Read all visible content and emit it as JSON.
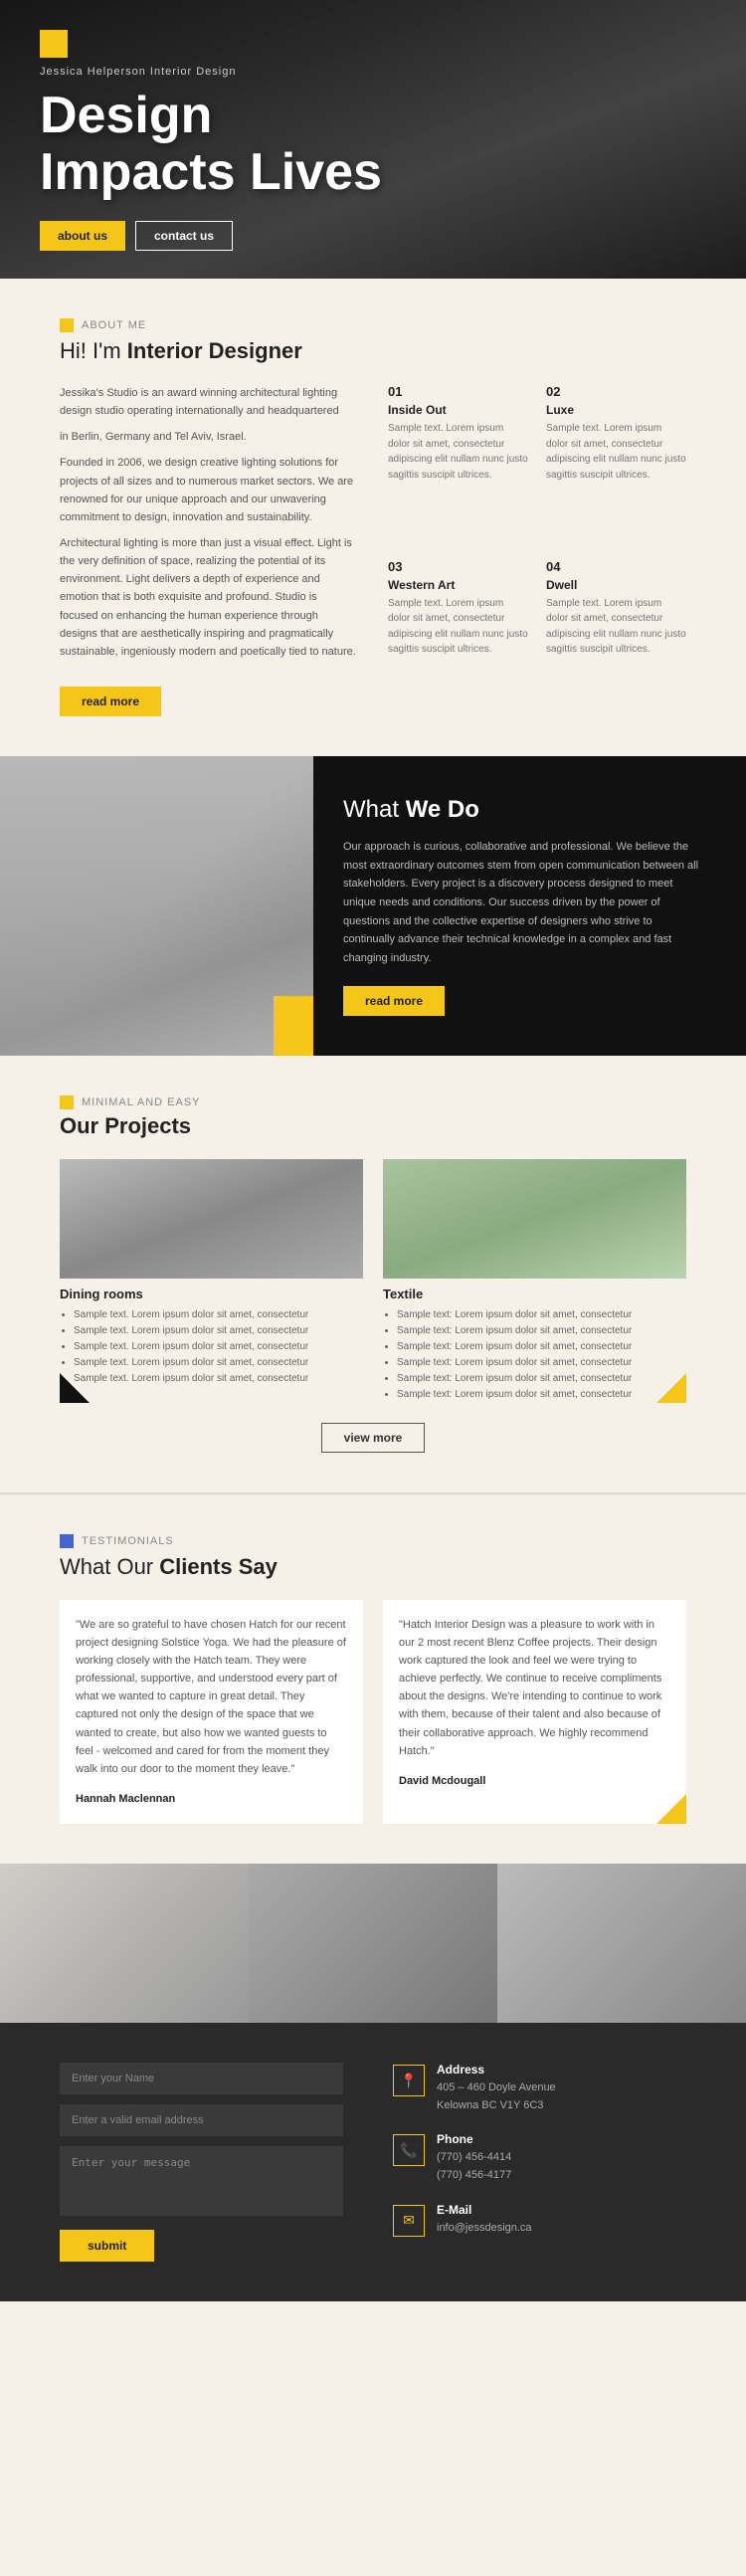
{
  "hero": {
    "brand": "Jessica Helperson Interior Design",
    "title_line1": "Design",
    "title_line2": "Impacts Lives",
    "btn_about": "about us",
    "btn_contact": "contact us"
  },
  "about": {
    "section_label": "About  Me",
    "title_pre": "Hi! I'm ",
    "title_main": "Interior Designer",
    "left_p1": "Jessika's Studio is an award winning architectural lighting design studio operating internationally and headquartered",
    "left_p2": "in Berlin, Germany and Tel Aviv, Israel.",
    "left_p3": "Founded in 2006, we design creative lighting solutions for projects of all sizes and to numerous market sectors. We are renowned for our unique approach and our unwavering commitment to design, innovation and sustainability.",
    "left_p4": "Architectural lighting is more than just a visual effect. Light is the very definition of space, realizing the potential of its environment. Light delivers a depth of experience and emotion that is both exquisite and profound. Studio is focused on enhancing the human experience through designs that are aesthetically inspiring and pragmatically sustainable, ingeniously modern and poetically tied to nature.",
    "read_more": "read more",
    "items": [
      {
        "num": "01",
        "title": "Inside Out",
        "text": "Sample text. Lorem ipsum dolor sit amet, consectetur adipiscing elit nullam nunc justo sagittis suscipit ultrices."
      },
      {
        "num": "02",
        "title": "Luxe",
        "text": "Sample text. Lorem ipsum dolor sit amet, consectetur adipiscing elit nullam nunc justo sagittis suscipit ultrices."
      },
      {
        "num": "03",
        "title": "Western Art",
        "text": "Sample text. Lorem ipsum dolor sit amet, consectetur adipiscing elit nullam nunc justo sagittis suscipit ultrices."
      },
      {
        "num": "04",
        "title": "Dwell",
        "text": "Sample text. Lorem ipsum dolor sit amet, consectetur adipiscing elit nullam nunc justo sagittis suscipit ultrices."
      }
    ]
  },
  "what": {
    "title_pre": "What ",
    "title_main": "We Do",
    "text": "Our approach is curious, collaborative and professional. We believe the most extraordinary outcomes stem from open communication between all stakeholders.\nEvery project is a discovery process designed to meet unique needs and conditions.\nOur success driven by the power of questions and the collective expertise of designers who strive to continually advance their technical knowledge in a complex and fast changing industry.",
    "read_more": "read more"
  },
  "projects": {
    "section_label": "Minimal and Easy",
    "title": "Our Projects",
    "items": [
      {
        "title": "Dining rooms",
        "bullets": [
          "Sample text. Lorem ipsum dolor sit amet, consectetur",
          "Sample text. Lorem ipsum dolor sit amet, consectetur",
          "Sample text. Lorem ipsum dolor sit amet, consectetur",
          "Sample text. Lorem ipsum dolor sit amet, consectetur",
          "Sample text. Lorem ipsum dolor sit amet, consectetur"
        ]
      },
      {
        "title": "Textile",
        "bullets": [
          "Sample text: Lorem ipsum dolor sit amet, consectetur",
          "Sample text: Lorem ipsum dolor sit amet, consectetur",
          "Sample text: Lorem ipsum dolor sit amet, consectetur",
          "Sample text: Lorem ipsum dolor sit amet, consectetur",
          "Sample text: Lorem ipsum dolor sit amet, consectetur",
          "Sample text: Lorem ipsum dolor sit amet, consectetur"
        ]
      }
    ],
    "view_more": "view more"
  },
  "testimonials": {
    "section_label": "Testimonials",
    "title_pre": "What Our ",
    "title_main": "Clients Say",
    "items": [
      {
        "text": "\"We are so grateful to have chosen Hatch for our recent project designing Solstice Yoga. We had the pleasure of working closely with the Hatch team. They were professional, supportive, and understood every part of what we wanted to capture in great detail. They captured not only the design of the space that we wanted to create, but also how we wanted guests to feel - welcomed and cared for from the moment they walk into our door to the moment they leave.\"",
        "author": "Hannah Maclennan"
      },
      {
        "text": "\"Hatch Interior Design was a pleasure to work with in our 2 most recent Blenz Coffee projects. Their design work captured the look and feel we were trying to achieve perfectly. We continue to receive compliments about the designs. We're intending to continue to work with them, because of their talent and also because of their collaborative approach. We highly recommend Hatch.\"",
        "author": "David Mcdougall"
      }
    ]
  },
  "contact": {
    "name_placeholder": "Enter your Name",
    "email_placeholder": "Enter a valid email address",
    "message_placeholder": "Enter your message",
    "submit_label": "submit",
    "info": [
      {
        "icon": "📍",
        "label": "Address",
        "lines": [
          "405 - 460 Doyle Avenue",
          "Kelowna BC V1Y 6C3"
        ]
      },
      {
        "icon": "📞",
        "label": "Phone",
        "lines": [
          "(770) 456-4414",
          "(770) 456-4177"
        ]
      },
      {
        "icon": "✉",
        "label": "E-Mail",
        "lines": [
          "info@jessdesign.ca"
        ]
      }
    ]
  }
}
